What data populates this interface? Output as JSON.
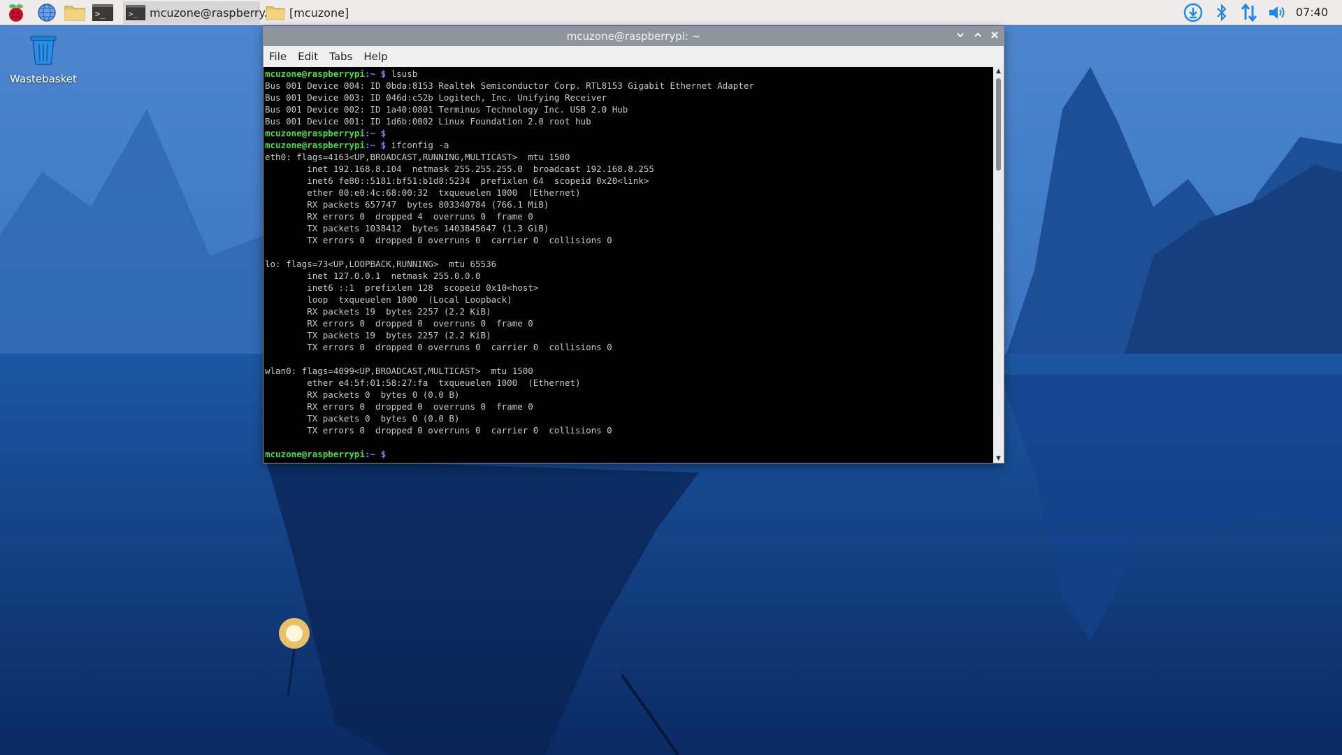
{
  "taskbar": {
    "launchers": [
      {
        "name": "raspberry-menu-icon"
      },
      {
        "name": "web-browser-icon"
      },
      {
        "name": "file-manager-icon"
      },
      {
        "name": "terminal-icon"
      }
    ],
    "tasks": [
      {
        "label": "mcuzone@raspberry...",
        "icon": "terminal-icon",
        "active": true
      },
      {
        "label": "[mcuzone]",
        "icon": "folder-icon",
        "active": false
      }
    ],
    "tray": [
      "download-icon",
      "bluetooth-icon",
      "network-icon",
      "volume-icon"
    ],
    "clock": "07:40"
  },
  "desktop": {
    "icons": [
      {
        "label": "Wastebasket",
        "icon": "trash-icon"
      }
    ]
  },
  "terminal": {
    "title": "mcuzone@raspberrypi: ~",
    "menu": [
      "File",
      "Edit",
      "Tabs",
      "Help"
    ],
    "prompt_user": "mcuzone@raspberrypi",
    "prompt_path": ":~ $",
    "lines": [
      {
        "type": "prompt",
        "cmd": " lsusb"
      },
      {
        "type": "out",
        "text": "Bus 001 Device 004: ID 0bda:8153 Realtek Semiconductor Corp. RTL8153 Gigabit Ethernet Adapter"
      },
      {
        "type": "out",
        "text": "Bus 001 Device 003: ID 046d:c52b Logitech, Inc. Unifying Receiver"
      },
      {
        "type": "out",
        "text": "Bus 001 Device 002: ID 1a40:0801 Terminus Technology Inc. USB 2.0 Hub"
      },
      {
        "type": "out",
        "text": "Bus 001 Device 001: ID 1d6b:0002 Linux Foundation 2.0 root hub"
      },
      {
        "type": "prompt",
        "cmd": ""
      },
      {
        "type": "prompt",
        "cmd": " ifconfig -a"
      },
      {
        "type": "out",
        "text": "eth0: flags=4163<UP,BROADCAST,RUNNING,MULTICAST>  mtu 1500"
      },
      {
        "type": "out",
        "text": "        inet 192.168.8.104  netmask 255.255.255.0  broadcast 192.168.8.255"
      },
      {
        "type": "out",
        "text": "        inet6 fe80::5181:bf51:b1d8:5234  prefixlen 64  scopeid 0x20<link>"
      },
      {
        "type": "out",
        "text": "        ether 00:e0:4c:68:00:32  txqueuelen 1000  (Ethernet)"
      },
      {
        "type": "out",
        "text": "        RX packets 657747  bytes 803340784 (766.1 MiB)"
      },
      {
        "type": "out",
        "text": "        RX errors 0  dropped 4  overruns 0  frame 0"
      },
      {
        "type": "out",
        "text": "        TX packets 1038412  bytes 1403845647 (1.3 GiB)"
      },
      {
        "type": "out",
        "text": "        TX errors 0  dropped 0 overruns 0  carrier 0  collisions 0"
      },
      {
        "type": "out",
        "text": ""
      },
      {
        "type": "out",
        "text": "lo: flags=73<UP,LOOPBACK,RUNNING>  mtu 65536"
      },
      {
        "type": "out",
        "text": "        inet 127.0.0.1  netmask 255.0.0.0"
      },
      {
        "type": "out",
        "text": "        inet6 ::1  prefixlen 128  scopeid 0x10<host>"
      },
      {
        "type": "out",
        "text": "        loop  txqueuelen 1000  (Local Loopback)"
      },
      {
        "type": "out",
        "text": "        RX packets 19  bytes 2257 (2.2 KiB)"
      },
      {
        "type": "out",
        "text": "        RX errors 0  dropped 0  overruns 0  frame 0"
      },
      {
        "type": "out",
        "text": "        TX packets 19  bytes 2257 (2.2 KiB)"
      },
      {
        "type": "out",
        "text": "        TX errors 0  dropped 0 overruns 0  carrier 0  collisions 0"
      },
      {
        "type": "out",
        "text": ""
      },
      {
        "type": "out",
        "text": "wlan0: flags=4099<UP,BROADCAST,MULTICAST>  mtu 1500"
      },
      {
        "type": "out",
        "text": "        ether e4:5f:01:58:27:fa  txqueuelen 1000  (Ethernet)"
      },
      {
        "type": "out",
        "text": "        RX packets 0  bytes 0 (0.0 B)"
      },
      {
        "type": "out",
        "text": "        RX errors 0  dropped 0  overruns 0  frame 0"
      },
      {
        "type": "out",
        "text": "        TX packets 0  bytes 0 (0.0 B)"
      },
      {
        "type": "out",
        "text": "        TX errors 0  dropped 0 overruns 0  carrier 0  collisions 0"
      },
      {
        "type": "out",
        "text": ""
      },
      {
        "type": "prompt",
        "cmd": " "
      }
    ]
  },
  "colors": {
    "prompt_user": "#40e040",
    "prompt_path": "#6f8cff",
    "terminal_bg": "#000000",
    "terminal_fg": "#c8c8c8",
    "titlebar": "#8f959c",
    "panel": "#edeceb"
  }
}
